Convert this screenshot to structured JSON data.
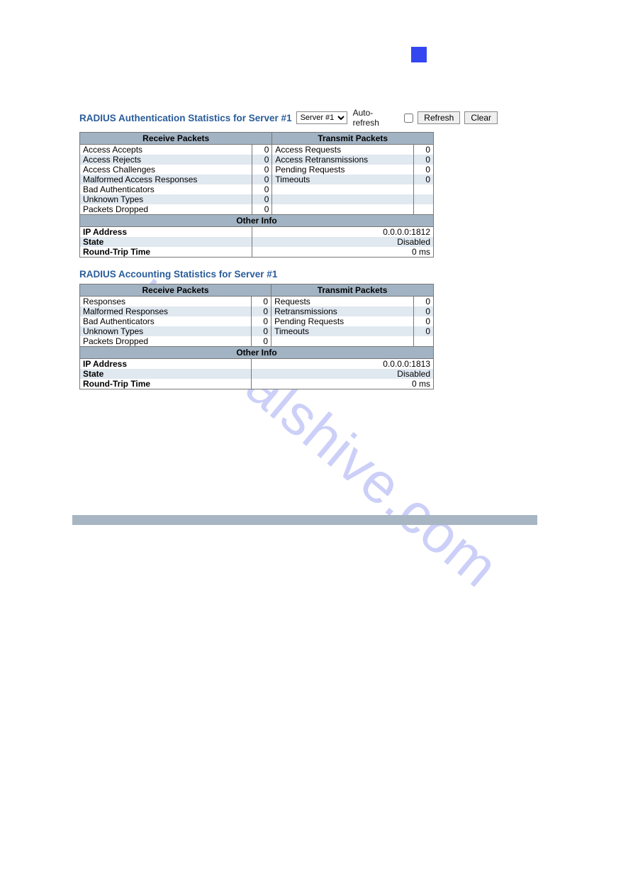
{
  "watermark": "manualshive.com",
  "auth": {
    "title": "RADIUS Authentication Statistics for Server #1",
    "server_option": "Server #1",
    "auto_refresh_label": "Auto-refresh",
    "refresh_btn": "Refresh",
    "clear_btn": "Clear",
    "header_receive": "Receive Packets",
    "header_transmit": "Transmit Packets",
    "rows": [
      {
        "rl": "Access Accepts",
        "rv": "0",
        "tl": "Access Requests",
        "tv": "0"
      },
      {
        "rl": "Access Rejects",
        "rv": "0",
        "tl": "Access Retransmissions",
        "tv": "0"
      },
      {
        "rl": "Access Challenges",
        "rv": "0",
        "tl": "Pending Requests",
        "tv": "0"
      },
      {
        "rl": "Malformed Access Responses",
        "rv": "0",
        "tl": "Timeouts",
        "tv": "0"
      },
      {
        "rl": "Bad Authenticators",
        "rv": "0",
        "tl": "",
        "tv": ""
      },
      {
        "rl": "Unknown Types",
        "rv": "0",
        "tl": "",
        "tv": ""
      },
      {
        "rl": "Packets Dropped",
        "rv": "0",
        "tl": "",
        "tv": ""
      }
    ],
    "other_info_header": "Other Info",
    "info": [
      {
        "label": "IP Address",
        "value": "0.0.0.0:1812"
      },
      {
        "label": "State",
        "value": "Disabled"
      },
      {
        "label": "Round-Trip Time",
        "value": "0 ms"
      }
    ]
  },
  "acct": {
    "title": "RADIUS Accounting Statistics for Server #1",
    "header_receive": "Receive Packets",
    "header_transmit": "Transmit Packets",
    "rows": [
      {
        "rl": "Responses",
        "rv": "0",
        "tl": "Requests",
        "tv": "0"
      },
      {
        "rl": "Malformed Responses",
        "rv": "0",
        "tl": "Retransmissions",
        "tv": "0"
      },
      {
        "rl": "Bad Authenticators",
        "rv": "0",
        "tl": "Pending Requests",
        "tv": "0"
      },
      {
        "rl": "Unknown Types",
        "rv": "0",
        "tl": "Timeouts",
        "tv": "0"
      },
      {
        "rl": "Packets Dropped",
        "rv": "0",
        "tl": "",
        "tv": ""
      }
    ],
    "other_info_header": "Other Info",
    "info": [
      {
        "label": "IP Address",
        "value": "0.0.0.0:1813"
      },
      {
        "label": "State",
        "value": "Disabled"
      },
      {
        "label": "Round-Trip Time",
        "value": "0 ms"
      }
    ]
  }
}
